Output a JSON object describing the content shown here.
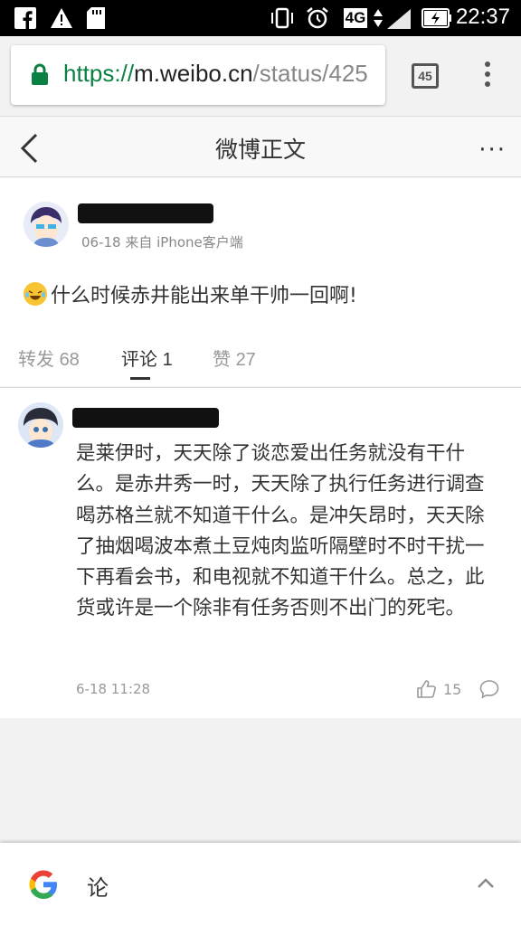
{
  "status_bar": {
    "left_icons": [
      "facebook-icon",
      "warning-icon",
      "sd-card-icon"
    ],
    "right_icons": [
      "vibrate-icon",
      "alarm-icon",
      "network-4g-icon",
      "signal-icon",
      "battery-charging-icon"
    ],
    "network_label": "4G",
    "time": "22:37"
  },
  "browser": {
    "url_protocol": "https://",
    "url_host": "m.weibo.cn",
    "url_path": "/status/425",
    "tab_count": "45"
  },
  "header": {
    "title": "微博正文",
    "more": "···"
  },
  "post": {
    "meta": "06-18 来自 iPhone客户端",
    "text": "什么时候赤井能出来单干帅一回啊!",
    "tabs": [
      {
        "label": "转发",
        "count": "68"
      },
      {
        "label": "评论",
        "count": "1"
      },
      {
        "label": "赞",
        "count": "27"
      }
    ],
    "active_tab": "评论"
  },
  "comment": {
    "text": "是莱伊时，天天除了谈恋爱出任务就没有干什么。是赤井秀一时，天天除了执行任务进行调查喝苏格兰就不知道干什么。是冲矢昂时，天天除了抽烟喝波本煮土豆炖肉监听隔壁时不时干扰一下再看会书，和电视就不知道干什么。总之，此货或许是一个除非有任务否则不出门的死宅。",
    "time": "6-18 11:28",
    "likes": "15"
  },
  "google_bar": {
    "query": "论"
  },
  "colors": {
    "url_green": "#0b8043",
    "tab_active": "#333333",
    "tab_inactive": "#999999"
  }
}
